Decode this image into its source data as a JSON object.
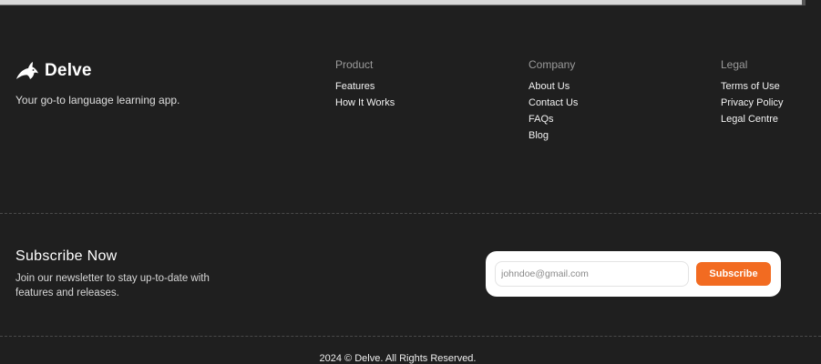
{
  "brand": {
    "name": "Delve",
    "tagline": "Your go-to language learning app.",
    "logo_icon": "dolphin-icon"
  },
  "columns": {
    "product": {
      "heading": "Product",
      "links": [
        "Features",
        "How It Works"
      ]
    },
    "company": {
      "heading": "Company",
      "links": [
        "About Us",
        "Contact Us",
        "FAQs",
        "Blog"
      ]
    },
    "legal": {
      "heading": "Legal",
      "links": [
        "Terms of Use",
        "Privacy Policy",
        "Legal Centre"
      ]
    }
  },
  "subscribe": {
    "title": "Subscribe Now",
    "description": "Join our newsletter to stay up-to-date with features and releases.",
    "email_placeholder": "johndoe@gmail.com",
    "email_value": "",
    "button_label": "Subscribe"
  },
  "footer": {
    "copyright": "2024 © Delve. All Rights Reserved."
  },
  "colors": {
    "background": "#1f1f1f",
    "accent": "#f26b21",
    "heading_muted": "#9b9b9b",
    "text": "#f2f2f2"
  }
}
